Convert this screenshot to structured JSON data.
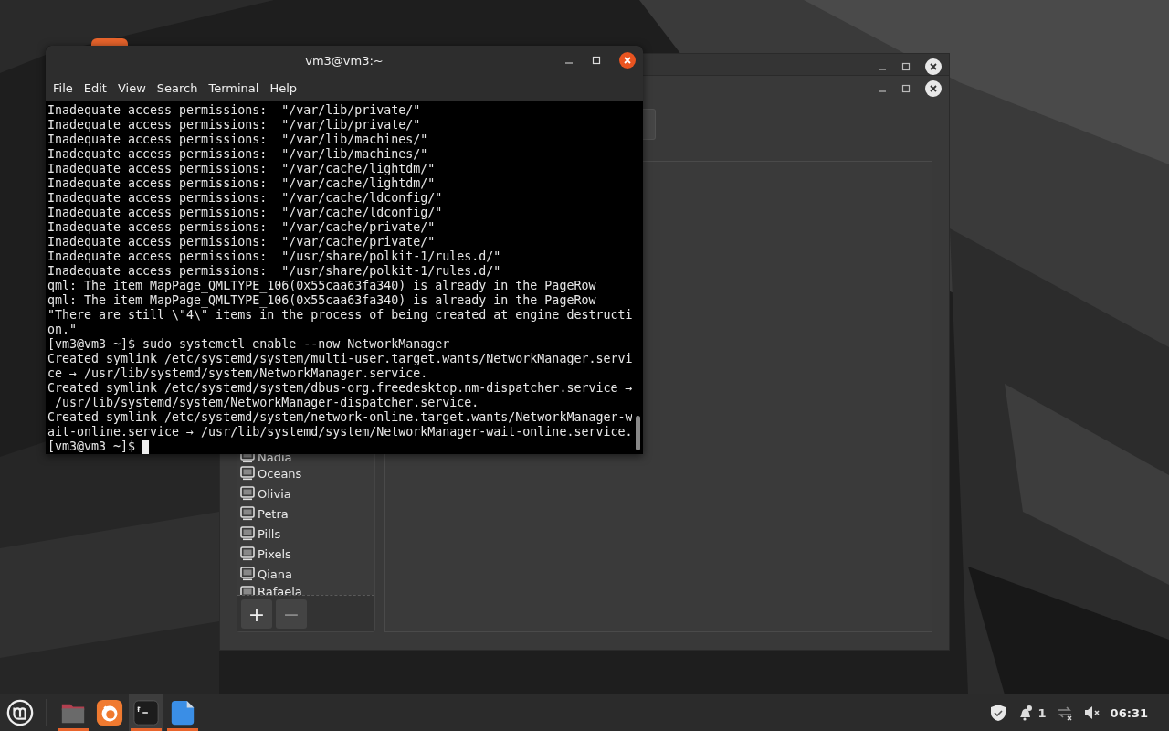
{
  "terminal": {
    "title": "vm3@vm3:~",
    "menu": [
      "File",
      "Edit",
      "View",
      "Search",
      "Terminal",
      "Help"
    ],
    "lines": [
      "Inadequate access permissions:  \"/var/lib/private/\"",
      "Inadequate access permissions:  \"/var/lib/private/\"",
      "Inadequate access permissions:  \"/var/lib/machines/\"",
      "Inadequate access permissions:  \"/var/lib/machines/\"",
      "Inadequate access permissions:  \"/var/cache/lightdm/\"",
      "Inadequate access permissions:  \"/var/cache/lightdm/\"",
      "Inadequate access permissions:  \"/var/cache/ldconfig/\"",
      "Inadequate access permissions:  \"/var/cache/ldconfig/\"",
      "Inadequate access permissions:  \"/var/cache/private/\"",
      "Inadequate access permissions:  \"/var/cache/private/\"",
      "Inadequate access permissions:  \"/usr/share/polkit-1/rules.d/\"",
      "Inadequate access permissions:  \"/usr/share/polkit-1/rules.d/\"",
      "qml: The item MapPage_QMLTYPE_106(0x55caa63fa340) is already in the PageRow",
      "qml: The item MapPage_QMLTYPE_106(0x55caa63fa340) is already in the PageRow",
      "\"There are still \\\"4\\\" items in the process of being created at engine destructi",
      "on.\"",
      "[vm3@vm3 ~]$ sudo systemctl enable --now NetworkManager",
      "Created symlink /etc/systemd/system/multi-user.target.wants/NetworkManager.servi",
      "ce → /usr/lib/systemd/system/NetworkManager.service.",
      "Created symlink /etc/systemd/system/dbus-org.freedesktop.nm-dispatcher.service →",
      " /usr/lib/systemd/system/NetworkManager-dispatcher.service.",
      "Created symlink /etc/systemd/system/network-online.target.wants/NetworkManager-w",
      "ait-online.service → /usr/lib/systemd/system/NetworkManager-wait-online.service."
    ],
    "prompt": "[vm3@vm3 ~]$ "
  },
  "background_window": {
    "items": [
      "Nadia",
      "Oceans",
      "Olivia",
      "Petra",
      "Pills",
      "Pixels",
      "Qiana",
      "Rafaela"
    ],
    "buttons": [
      "+",
      "−"
    ]
  },
  "taskbar": {
    "launchers": [
      {
        "kind": "folder",
        "running": true,
        "selected": false
      },
      {
        "kind": "browser",
        "running": false,
        "selected": false
      },
      {
        "kind": "terminal",
        "running": true,
        "selected": true
      },
      {
        "kind": "document",
        "running": true,
        "selected": false
      }
    ],
    "notification_count": "1",
    "clock": "06:31"
  }
}
